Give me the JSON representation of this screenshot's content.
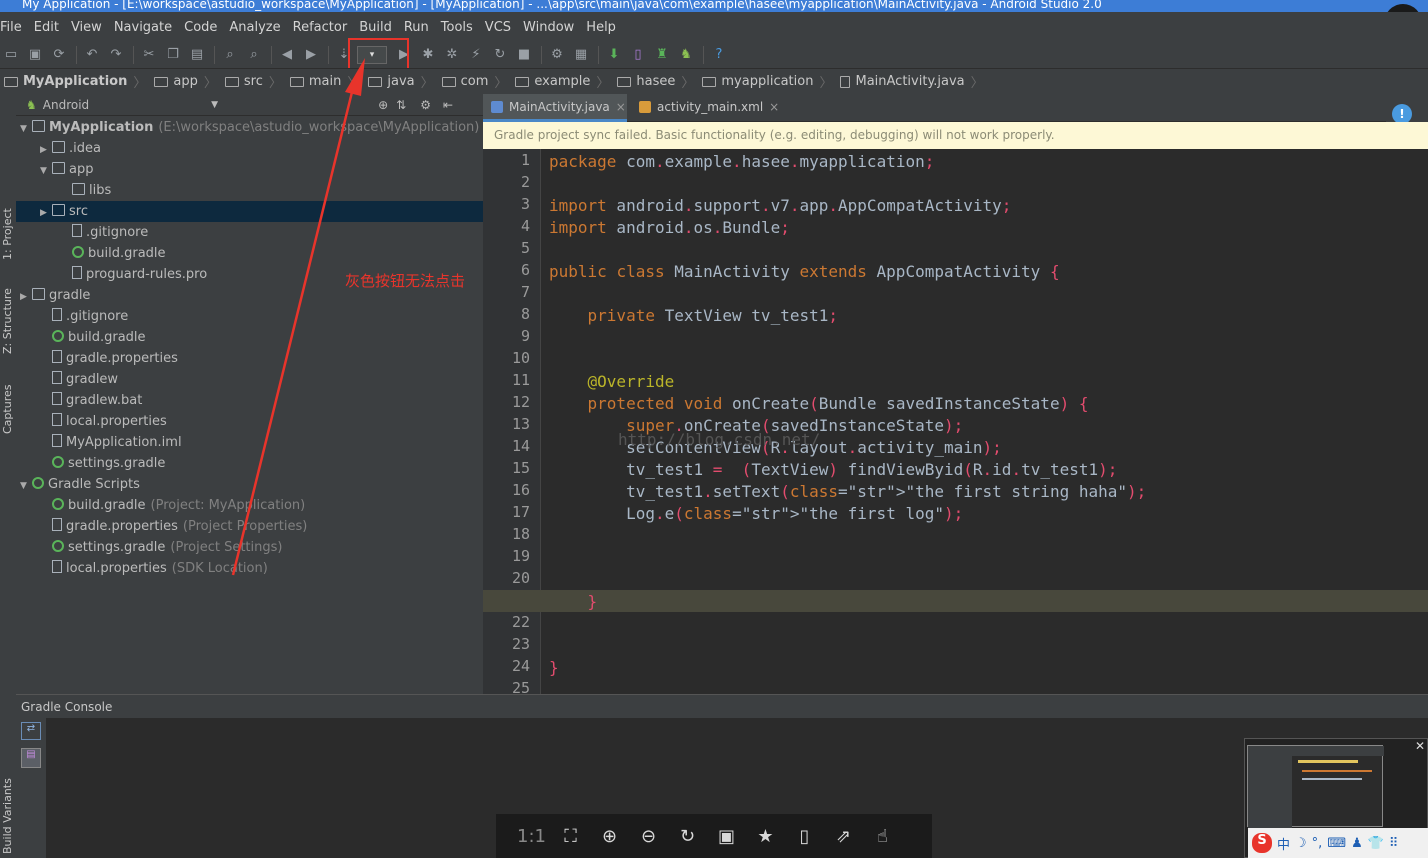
{
  "window": {
    "title": "My Application - [E:\\workspace\\astudio_workspace\\MyApplication] - [MyApplication] - ...\\app\\src\\main\\java\\com\\example\\hasee\\myapplication\\MainActivity.java - Android Studio 2.0",
    "close": "✕"
  },
  "menu": [
    "File",
    "Edit",
    "View",
    "Navigate",
    "Code",
    "Analyze",
    "Refactor",
    "Build",
    "Run",
    "Tools",
    "VCS",
    "Window",
    "Help"
  ],
  "breadcrumb": [
    "MyApplication",
    "app",
    "src",
    "main",
    "java",
    "com",
    "example",
    "hasee",
    "myapplication",
    "MainActivity.java"
  ],
  "left_tool_tabs": [
    "1: Project",
    "Z: Structure",
    "Captures",
    "Build Variants"
  ],
  "project_panel": {
    "view_mode": "Android",
    "tree": [
      {
        "label": "MyApplication",
        "hint": "(E:\\workspace\\astudio_workspace\\MyApplication)",
        "icon": "folder-icon",
        "expanded": true
      },
      {
        "label": ".idea",
        "icon": "folder-icon",
        "expanded": false
      },
      {
        "label": "app",
        "icon": "folder-icon",
        "expanded": true
      },
      {
        "label": "libs",
        "icon": "folder-icon"
      },
      {
        "label": "src",
        "icon": "folder-icon",
        "expanded": false,
        "selected": true
      },
      {
        "label": ".gitignore",
        "icon": "file-icon"
      },
      {
        "label": "build.gradle",
        "icon": "gradle-icon"
      },
      {
        "label": "proguard-rules.pro",
        "icon": "file-icon"
      },
      {
        "label": "gradle",
        "icon": "folder-icon",
        "expanded": false
      },
      {
        "label": ".gitignore",
        "icon": "file-icon"
      },
      {
        "label": "build.gradle",
        "icon": "gradle-icon"
      },
      {
        "label": "gradle.properties",
        "icon": "file-icon"
      },
      {
        "label": "gradlew",
        "icon": "file-icon"
      },
      {
        "label": "gradlew.bat",
        "icon": "file-icon"
      },
      {
        "label": "local.properties",
        "icon": "file-icon"
      },
      {
        "label": "MyApplication.iml",
        "icon": "file-icon"
      },
      {
        "label": "settings.gradle",
        "icon": "gradle-icon"
      },
      {
        "label": "Gradle Scripts",
        "icon": "gradle-icon",
        "expanded": true
      },
      {
        "label": "build.gradle",
        "hint": "(Project: MyApplication)",
        "icon": "gradle-icon"
      },
      {
        "label": "gradle.properties",
        "hint": "(Project Properties)",
        "icon": "file-icon"
      },
      {
        "label": "settings.gradle",
        "hint": "(Project Settings)",
        "icon": "gradle-icon"
      },
      {
        "label": "local.properties",
        "hint": "(SDK Location)",
        "icon": "file-icon"
      }
    ]
  },
  "annotation": "灰色按钮无法点击",
  "editor_tabs": [
    {
      "label": "MainActivity.java",
      "active": true
    },
    {
      "label": "activity_main.xml",
      "active": false
    }
  ],
  "notification": "Gradle project sync failed. Basic functionality (e.g. editing, debugging) will not work properly.",
  "code_lines": [
    "package com.example.hasee.myapplication;",
    "",
    "import android.support.v7.app.AppCompatActivity;",
    "import android.os.Bundle;",
    "",
    "public class MainActivity extends AppCompatActivity {",
    "",
    "    private TextView tv_test1;",
    "",
    "",
    "    @Override",
    "    protected void onCreate(Bundle savedInstanceState) {",
    "        super.onCreate(savedInstanceState);",
    "        setContentView(R.layout.activity_main);",
    "        tv_test1 =  (TextView) findViewByid(R.id.tv_test1);",
    "        tv_test1.setText(\"the first string haha\");",
    "        Log.e(\"the first log\");",
    "",
    "",
    "",
    "    }",
    "",
    "",
    "}",
    ""
  ],
  "watermark": "http://blog.csdn.net/",
  "console": {
    "title": "Gradle Console"
  },
  "viewer_toolbar": [
    "1:1",
    "fit-icon",
    "zoom-in-icon",
    "zoom-out-icon",
    "rotate-icon",
    "save-icon",
    "bookmark-icon",
    "phone-icon",
    "share-icon",
    "like-icon"
  ],
  "ime": {
    "brand": "S",
    "items": [
      "中",
      "☽",
      "°,",
      "⌨",
      "♟",
      "👕",
      "⠿"
    ]
  }
}
